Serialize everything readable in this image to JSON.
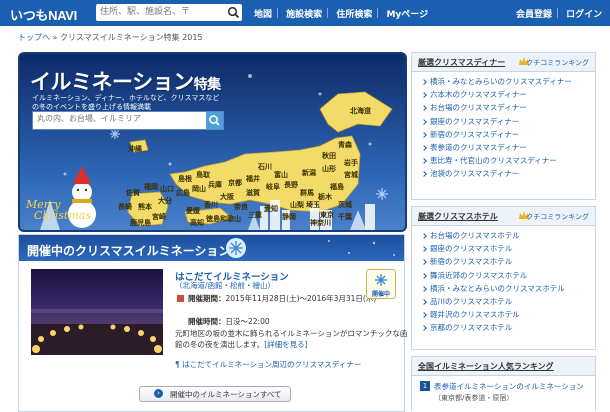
{
  "header": {
    "logo": "いつもNAVI",
    "search_placeholder": "住所、駅、施設名、〒",
    "nav": [
      "地図",
      "施設検索",
      "住所検索",
      "Myページ"
    ],
    "user_links": [
      "会員登録",
      "ログイン"
    ]
  },
  "breadcrumb": {
    "home": "トップへ",
    "separator": "»",
    "current": "クリスマスイルミネーション特集 2015"
  },
  "hero": {
    "title_main": "イルミネーション",
    "title_suffix": "特集",
    "subtitle": "イルミネーション、ディナー、ホテルなど、クリスマスなどの冬のイベントを盛り上げる情報満載",
    "search_placeholder": "丸の内、お台場、イルミリア",
    "merry": "Merry",
    "christmas": "Christmas",
    "prefectures": [
      "北海道",
      "青森",
      "秋田",
      "岩手",
      "宮城",
      "山形",
      "福島",
      "新潟",
      "石川",
      "富山",
      "栃木",
      "群馬",
      "茨城",
      "長野",
      "埼玉",
      "東京",
      "千葉",
      "神奈川",
      "山梨",
      "岐阜",
      "静岡",
      "愛知",
      "福井",
      "滋賀",
      "京都",
      "三重",
      "奈良",
      "大阪",
      "兵庫",
      "和歌山",
      "鳥取",
      "岡山",
      "島根",
      "広島",
      "山口",
      "香川",
      "徳島",
      "愛媛",
      "高知",
      "福岡",
      "佐賀",
      "長崎",
      "大分",
      "熊本",
      "宮崎",
      "鹿児島",
      "沖縄"
    ]
  },
  "section": {
    "title": "開催中のクリスマスイルミネーション",
    "event": {
      "title": "はこだてイルミネーション",
      "location": "（北海道/函館・松前・檜山）",
      "period_label": "開催期間：",
      "period_value": "2015年11月28日(土)～2016年3月31日(木)",
      "hours_label": "開催時間：",
      "hours_value": "日没～22:00",
      "description": "元町地区の坂の並木に飾られるイルミネーションがロマンチックな函館の冬の夜を演出します。",
      "detail_link": "[詳細を見る]",
      "nearby_link": "はこだてイルミネーション周辺のクリスマスディナー",
      "badge": "開催中"
    },
    "all_button": "開催中のイルミネーションすべて"
  },
  "dinner_panel": {
    "title": "厳選クリスマスディナー",
    "ranking": "クチコミランキング",
    "items": [
      "横浜・みなとみらいのクリスマスディナー",
      "六本木のクリスマスディナー",
      "お台場のクリスマスディナー",
      "銀座のクリスマスディナー",
      "新宿のクリスマスディナー",
      "表参道のクリスマスディナー",
      "恵比寿・代官山のクリスマスディナー",
      "池袋のクリスマスディナー"
    ]
  },
  "hotel_panel": {
    "title": "厳選クリスマスホテル",
    "ranking": "クチコミランキング",
    "items": [
      "お台場のクリスマスホテル",
      "銀座のクリスマスホテル",
      "新宿のクリスマスホテル",
      "舞浜近郊のクリスマスホテル",
      "横浜・みなとみらいのクリスマスホテル",
      "品川のクリスマスホテル",
      "軽井沢のクリスマスホテル",
      "京都のクリスマスホテル"
    ]
  },
  "rank_panel": {
    "title": "全国イルミネーション人気ランキング",
    "rank": "1",
    "item": "表参道イルミネーションのイルミネーション",
    "item_loc": "（東京都/表参道・原宿）"
  }
}
